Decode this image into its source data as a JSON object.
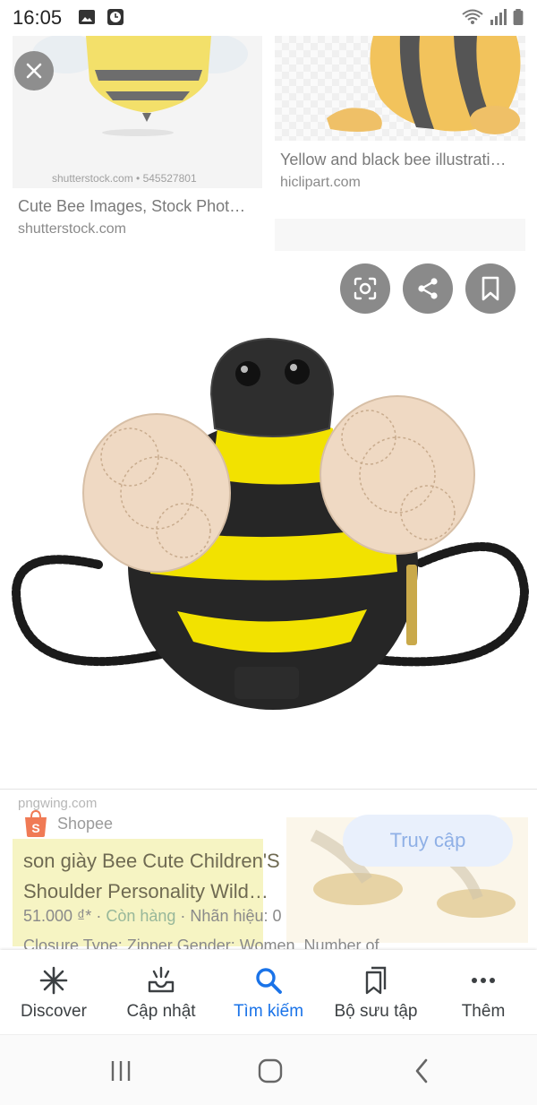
{
  "status": {
    "time": "16:05",
    "icons": [
      "image-icon",
      "clock-icon",
      "wifi-icon",
      "signal-icon",
      "battery-icon"
    ]
  },
  "results": [
    {
      "title": "Cute Bee Images, Stock Phot…",
      "source": "shutterstock.com",
      "watermark": "shutterstock.com • 545527801"
    },
    {
      "title": "Yellow and black bee illustrati…",
      "source": "hiclipart.com"
    }
  ],
  "actions": {
    "lens": "lens-icon",
    "share": "share-icon",
    "save": "bookmark-icon"
  },
  "detail": {
    "watermark": "pngwing.com",
    "store": "Shopee",
    "visit_label": "Truy cập",
    "title": "son giày Bee Cute Children'S Shoulder Personality Wild…",
    "price": "51.000 ₫*",
    "stock": "Còn hàng",
    "brand": "Nhãn hiệu: 0",
    "description": "Closure Type: Zipper Gender: Women, Number of"
  },
  "bottom_nav": [
    {
      "label": "Discover",
      "icon": "asterisk-icon",
      "active": false
    },
    {
      "label": "Cập nhật",
      "icon": "updates-icon",
      "active": false
    },
    {
      "label": "Tìm kiếm",
      "icon": "search-icon",
      "active": true
    },
    {
      "label": "Bộ sưu tập",
      "icon": "collections-icon",
      "active": false
    },
    {
      "label": "Thêm",
      "icon": "more-icon",
      "active": false
    }
  ],
  "colors": {
    "accent": "#1a73e8",
    "bee_yellow": "#f2e200",
    "bee_black": "#262626",
    "wing": "#efd9c3"
  }
}
